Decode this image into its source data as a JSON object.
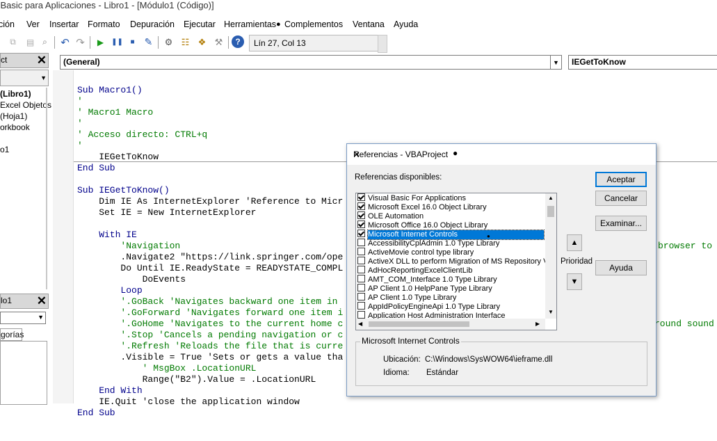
{
  "window": {
    "title": "l Basic para Aplicaciones - Libro1 - [Módulo1 (Código)]"
  },
  "menu": [
    "ción",
    "Ver",
    "Insertar",
    "Formato",
    "Depuración",
    "Ejecutar",
    "Herramientas",
    "Complementos",
    "Ventana",
    "Ayuda"
  ],
  "toolbar": {
    "position": "Lín 27, Col 13"
  },
  "project_panel": {
    "title": "ct",
    "tree": [
      "(Libro1)",
      "Excel Objetos",
      "(Hoja1)",
      "orkbook",
      "o1"
    ]
  },
  "properties_panel": {
    "title": "lo1",
    "tab": "gorías"
  },
  "code_header": {
    "object": "(General)",
    "procedure": "IEGetToKnow"
  },
  "code": {
    "macro1": [
      "Sub Macro1()",
      "'",
      "' Macro1 Macro",
      "'",
      "' Acceso directo: CTRL+q",
      "'",
      "    IEGetToKnow",
      "End Sub"
    ],
    "ie_sub_head": "Sub IEGetToKnow()",
    "dim_line": "    Dim IE As InternetExplorer 'Reference to Micr",
    "set_line": "    Set IE = New InternetExplorer",
    "with_line": "    With IE",
    "lines": [
      "        'Navigation",
      "        .Navigate2 \"https://link.springer.com/ope",
      "        Do Until IE.ReadyState = READYSTATE_COMPL",
      "            DoEvents",
      "        Loop",
      "        '.GoBack 'Navigates backward one item in",
      "        '.GoForward 'Navigates forward one item i",
      "        '.GoHome 'Navigates to the current home c",
      "        '.Stop 'Cancels a pending navigation or c",
      "        '.Refresh 'Reloads the file that is curre",
      "        .Visible = True 'Sets or gets a value tha",
      "            ' MsgBox .LocationURL",
      "            Range(\"B2\").Value = .LocationURL",
      "    End With",
      "    IE.Quit 'close the application window",
      "End Sub"
    ],
    "right_overflow": [
      "browser to",
      "round sound"
    ]
  },
  "dialog": {
    "title": "Referencias - VBAProject",
    "available_label": "Referencias disponibles:",
    "buttons": {
      "accept": "Aceptar",
      "cancel": "Cancelar",
      "browse": "Examinar...",
      "help": "Ayuda"
    },
    "priority_label": "Prioridad",
    "references": [
      {
        "name": "Visual Basic For Applications",
        "checked": true
      },
      {
        "name": "Microsoft Excel 16.0 Object Library",
        "checked": true
      },
      {
        "name": "OLE Automation",
        "checked": true
      },
      {
        "name": "Microsoft Office 16.0 Object Library",
        "checked": true
      },
      {
        "name": "Microsoft Internet Controls",
        "checked": true,
        "selected": true
      },
      {
        "name": "AccessibilityCplAdmin 1.0 Type Library",
        "checked": false
      },
      {
        "name": "ActiveMovie control type library",
        "checked": false
      },
      {
        "name": "ActiveX DLL to perform Migration of MS Repository V:",
        "checked": false
      },
      {
        "name": "AdHocReportingExcelClientLib",
        "checked": false
      },
      {
        "name": "AMT_COM_Interface 1.0 Type Library",
        "checked": false
      },
      {
        "name": "AP Client 1.0 HelpPane Type Library",
        "checked": false
      },
      {
        "name": "AP Client 1.0 Type Library",
        "checked": false
      },
      {
        "name": "AppIdPolicyEngineApi 1.0 Type Library",
        "checked": false
      },
      {
        "name": "Application Host Administration Interface",
        "checked": false
      }
    ],
    "info": {
      "group_title": "Microsoft Internet Controls",
      "location_label": "Ubicación:",
      "location_value": "C:\\Windows\\SysWOW64\\ieframe.dll",
      "language_label": "Idioma:",
      "language_value": "Estándar"
    }
  }
}
